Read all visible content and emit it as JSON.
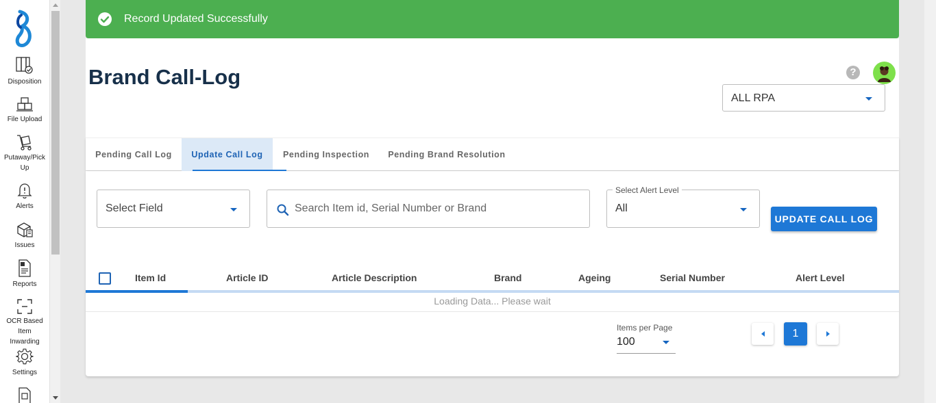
{
  "colors": {
    "accent": "#1e78d6",
    "toast_bg": "#4caf50",
    "title": "#17304a",
    "avatar_bg": "#7ee04b"
  },
  "sidebar": {
    "items": [
      {
        "label": "Disposition",
        "icon": "checklist-icon"
      },
      {
        "label": "File Upload",
        "icon": "boxes-icon"
      },
      {
        "label": "Putaway/Pick Up",
        "icon": "trolley-icon"
      },
      {
        "label": "Alerts",
        "icon": "bell-icon"
      },
      {
        "label": "Issues",
        "icon": "box-issue-icon"
      },
      {
        "label": "Reports",
        "icon": "report-icon"
      },
      {
        "label": "OCR Based Item Inwarding",
        "icon": "scan-icon"
      },
      {
        "label": "Settings",
        "icon": "gear-icon"
      }
    ]
  },
  "toast": {
    "message": "Record Updated Successfully"
  },
  "header": {
    "title": "Brand Call-Log",
    "help": "?",
    "rpa_select": "ALL RPA"
  },
  "tabs": [
    {
      "label": "Pending Call Log",
      "active": false
    },
    {
      "label": "Update Call Log",
      "active": true
    },
    {
      "label": "Pending Inspection",
      "active": false
    },
    {
      "label": "Pending Brand Resolution",
      "active": false
    }
  ],
  "filters": {
    "select_field_placeholder": "Select Field",
    "search_placeholder": "Search Item id, Serial Number or Brand",
    "alert_level_legend": "Select Alert Level",
    "alert_level_value": "All",
    "update_button": "UPDATE CALL LOG"
  },
  "table": {
    "columns": [
      "Item Id",
      "Article ID",
      "Article Description",
      "Brand",
      "Ageing",
      "Serial Number",
      "Alert Level"
    ],
    "loading_text": "Loading Data... Please wait"
  },
  "pagination": {
    "items_per_page_label": "Items per Page",
    "items_per_page": "100",
    "current_page": "1"
  }
}
